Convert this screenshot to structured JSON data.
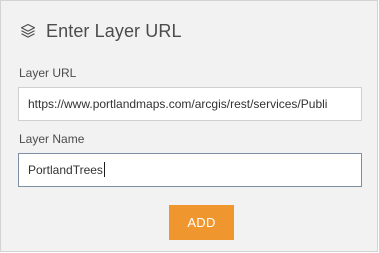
{
  "dialog": {
    "title": "Enter Layer URL",
    "title_icon": "layers-icon"
  },
  "layer_url": {
    "label": "Layer URL",
    "value": "https://www.portlandmaps.com/arcgis/rest/services/Publi"
  },
  "layer_name": {
    "label": "Layer Name",
    "value": "PortlandTrees"
  },
  "actions": {
    "add_label": "ADD"
  },
  "colors": {
    "panel_background": "#f2f2f2",
    "accent": "#f0962e",
    "focused_border": "#7d8fa3"
  }
}
